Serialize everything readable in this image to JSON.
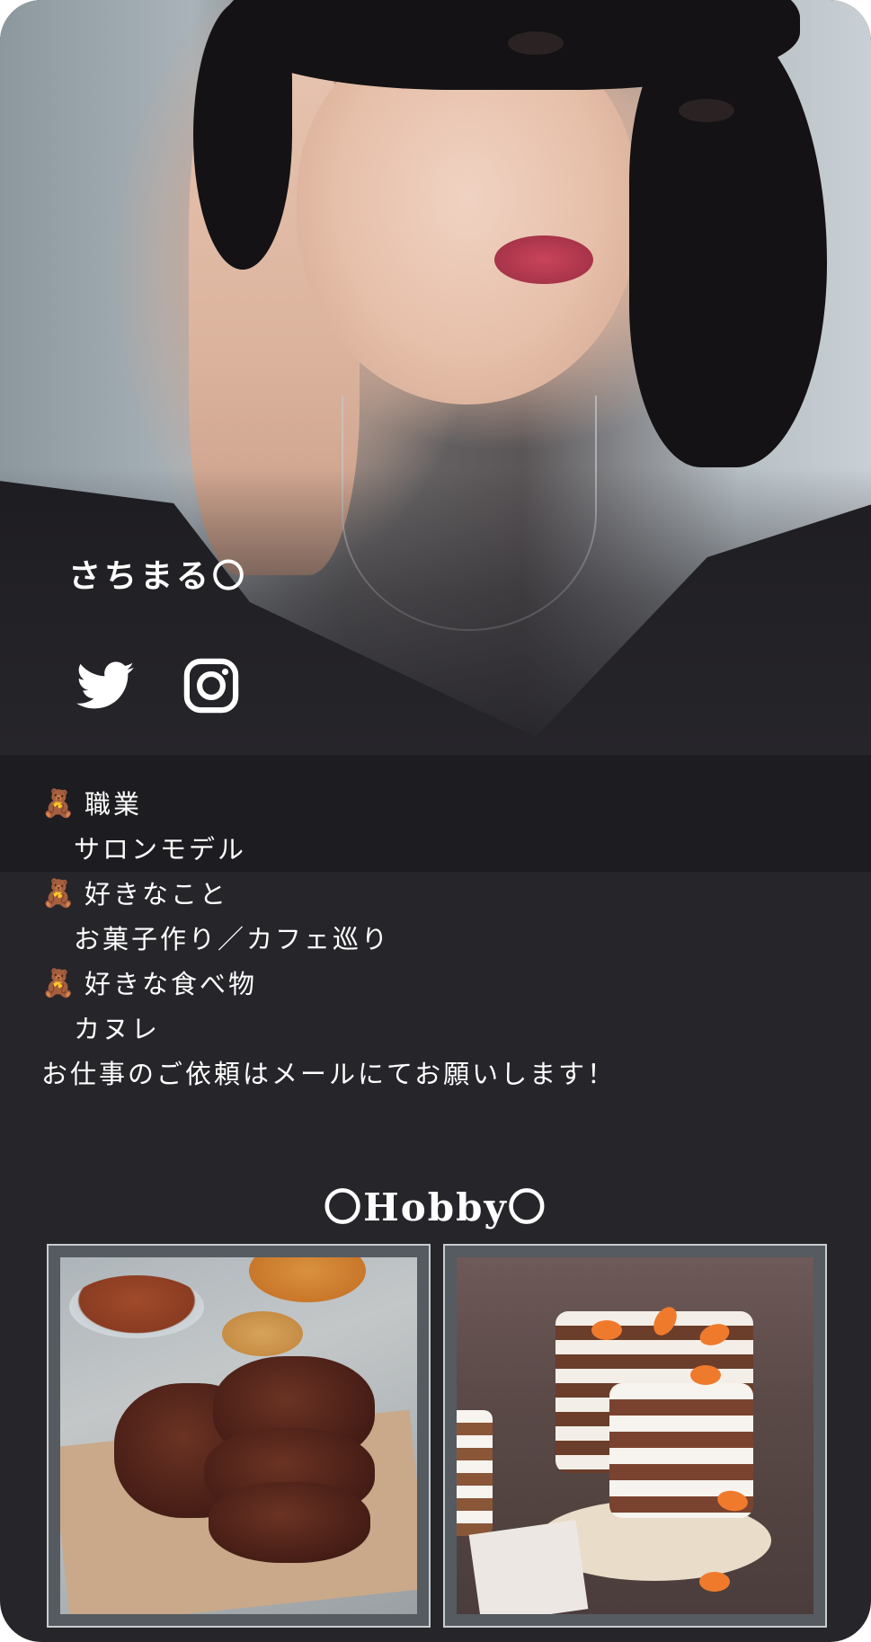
{
  "profile": {
    "name": "さちまる〇"
  },
  "social": {
    "twitter": "twitter-icon",
    "instagram": "instagram-icon"
  },
  "bio": {
    "bear_icon": "🧸",
    "items": [
      {
        "heading": "職業",
        "value": "サロンモデル"
      },
      {
        "heading": "好きなこと",
        "value": "お菓子作り／カフェ巡り"
      },
      {
        "heading": "好きな食べ物",
        "value": "カヌレ"
      }
    ],
    "note": "お仕事のご依頼はメールにてお願いします！"
  },
  "hobby": {
    "title": "〇Hobby〇"
  },
  "colors": {
    "background": "#26252a",
    "text": "#ffffff",
    "card_frame": "#555b60"
  }
}
